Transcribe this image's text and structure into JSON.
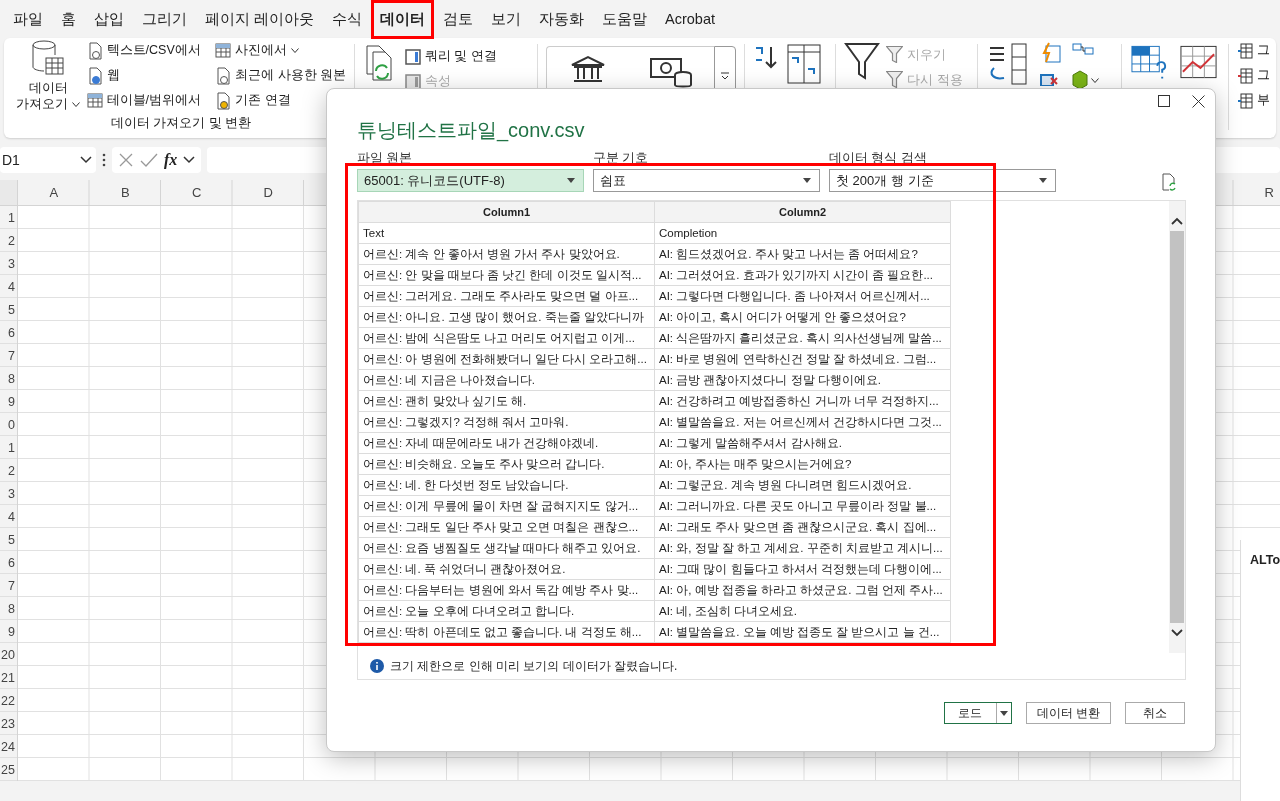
{
  "menu_tabs": [
    {
      "label": "파일",
      "selected": false
    },
    {
      "label": "홈",
      "selected": false
    },
    {
      "label": "삽입",
      "selected": false
    },
    {
      "label": "그리기",
      "selected": false
    },
    {
      "label": "페이지 레이아웃",
      "selected": false
    },
    {
      "label": "수식",
      "selected": false
    },
    {
      "label": "데이터",
      "selected": true
    },
    {
      "label": "검토",
      "selected": false
    },
    {
      "label": "보기",
      "selected": false
    },
    {
      "label": "자동화",
      "selected": false
    },
    {
      "label": "도움말",
      "selected": false
    },
    {
      "label": "Acrobat",
      "selected": false
    }
  ],
  "ribbon": {
    "get_data": [
      "데이터",
      "가져오기"
    ],
    "import_items": [
      {
        "label": "텍스트/CSV에서",
        "dropdown": false
      },
      {
        "label": "웹",
        "dropdown": false
      },
      {
        "label": "테이블/범위에서",
        "dropdown": false
      },
      {
        "label": "사진에서",
        "dropdown": true
      },
      {
        "label": "최근에 사용한 원본",
        "dropdown": false
      },
      {
        "label": "기존 연결",
        "dropdown": false
      }
    ],
    "group_label": "데이터 가져오기 및 변환",
    "query_items": [
      {
        "label": "쿼리 및 연결",
        "disabled": false
      },
      {
        "label": "속성",
        "disabled": true
      }
    ],
    "filter_items": [
      {
        "label": "지우기",
        "disabled": true
      },
      {
        "label": "다시 적용",
        "disabled": true
      }
    ],
    "edge_items": [
      "그",
      "그",
      "부"
    ]
  },
  "formula_bar": {
    "name_box": "D1",
    "fx": "fx"
  },
  "sheet": {
    "columns": [
      "A",
      "B",
      "C",
      "D"
    ],
    "last_column": "R",
    "rows": [
      "1",
      "2",
      "3",
      "4",
      "5",
      "6",
      "7",
      "8",
      "9",
      "0",
      "1",
      "2",
      "3",
      "4",
      "5",
      "6",
      "7",
      "8",
      "9",
      "20",
      "21",
      "22",
      "23",
      "24",
      "25"
    ]
  },
  "side_panel": {
    "title": "ALTo"
  },
  "dialog": {
    "title": "튜닝테스트파일_conv.csv",
    "fields": [
      {
        "label": "파일 원본",
        "value": "65001: 유니코드(UTF-8)",
        "focused": true
      },
      {
        "label": "구분 기호",
        "value": "쉼표",
        "focused": false
      },
      {
        "label": "데이터 형식 검색",
        "value": "첫 200개 행 기준",
        "focused": false
      }
    ],
    "columns": [
      "Column1",
      "Column2"
    ],
    "header_row": [
      "Text",
      "Completion"
    ],
    "rows": [
      [
        "어르신: 계속 안 좋아서 병원 가서 주사 맞았어요.",
        "AI: 힘드셨겠어요. 주사 맞고 나서는 좀 어떠세요?"
      ],
      [
        "어르신: 안 맞을 때보다 좀 낫긴 한데 이것도 일시적...",
        "AI: 그러셨어요. 효과가 있기까지 시간이 좀 필요한..."
      ],
      [
        "어르신: 그러게요. 그래도 주사라도 맞으면 덜 아프...",
        "AI: 그렇다면 다행입니다. 좀 나아져서 어르신께서..."
      ],
      [
        "어르신: 아니요. 고생 많이 했어요. 죽는줄 알았다니까",
        "AI: 아이고, 혹시 어디가 어떻게 안 좋으셨어요?"
      ],
      [
        "어르신: 밤에 식은땀도 나고 머리도 어지럽고 이게...",
        "AI: 식은땀까지 흘리셨군요. 혹시 의사선생님께 말씀..."
      ],
      [
        "어르신: 아 병원에 전화해봤더니 일단 다시 오라고해...",
        "AI: 바로 병원에 연락하신건 정말 잘 하셨네요. 그럼..."
      ],
      [
        "어르신: 네 지금은 나아졌습니다.",
        "AI: 금방 괜찮아지셨다니 정말 다행이에요."
      ],
      [
        "어르신: 괜히 맞았나 싶기도 해.",
        "AI: 건강하려고 예방접종하신 거니까 너무 걱정하지..."
      ],
      [
        "어르신: 그렇겠지? 걱정해 줘서 고마워.",
        "AI: 별말씀을요. 저는 어르신께서 건강하시다면 그것..."
      ],
      [
        "어르신: 자네 때문에라도 내가 건강해야겠네.",
        "AI: 그렇게 말씀해주셔서 감사해요."
      ],
      [
        "어르신: 비슷해요. 오늘도 주사 맞으러 갑니다.",
        "AI: 아, 주사는 매주 맞으시는거에요?"
      ],
      [
        "어르신: 네. 한 다섯번 정도 남았습니다.",
        "AI: 그렇군요. 계속 병원 다니려면 힘드시겠어요."
      ],
      [
        "어르신: 이게 무릎에 물이 차면 잘 굽혀지지도 않거...",
        "AI: 그러니까요. 다른 곳도 아니고 무릎이라 정말 불..."
      ],
      [
        "어르신: 그래도 일단 주사 맞고 오면 며칠은 괜찮으...",
        "AI: 그래도 주사 맞으면 좀 괜찮으시군요. 혹시 집에..."
      ],
      [
        "어르신: 요즘 냉찜질도 생각날 때마다 해주고 있어요.",
        "AI: 와, 정말 잘 하고 계세요. 꾸준히 치료받고 계시니..."
      ],
      [
        "어르신: 네. 푹 쉬었더니 괜찮아졌어요.",
        "AI: 그때 많이 힘들다고 하셔서 걱정했는데 다행이에..."
      ],
      [
        "어르신: 다음부터는 병원에 와서 독감 예방 주사 맞...",
        "AI: 아, 예방 접종을 하라고 하셨군요. 그럼 언제 주사..."
      ],
      [
        "어르신: 오늘 오후에 다녀오려고 합니다.",
        "AI: 네, 조심히 다녀오세요."
      ],
      [
        "어르신: 딱히 아픈데도 없고 좋습니다. 내 걱정도 해...",
        "AI: 별말씀을요. 오늘 예방 접종도 잘 받으시고 늘 건..."
      ]
    ],
    "note": "크기 제한으로 인해 미리 보기의 데이터가 잘렸습니다.",
    "buttons": [
      {
        "label": "로드",
        "kind": "split"
      },
      {
        "label": "데이터 변환",
        "kind": "plain"
      },
      {
        "label": "취소",
        "kind": "plain"
      }
    ]
  }
}
